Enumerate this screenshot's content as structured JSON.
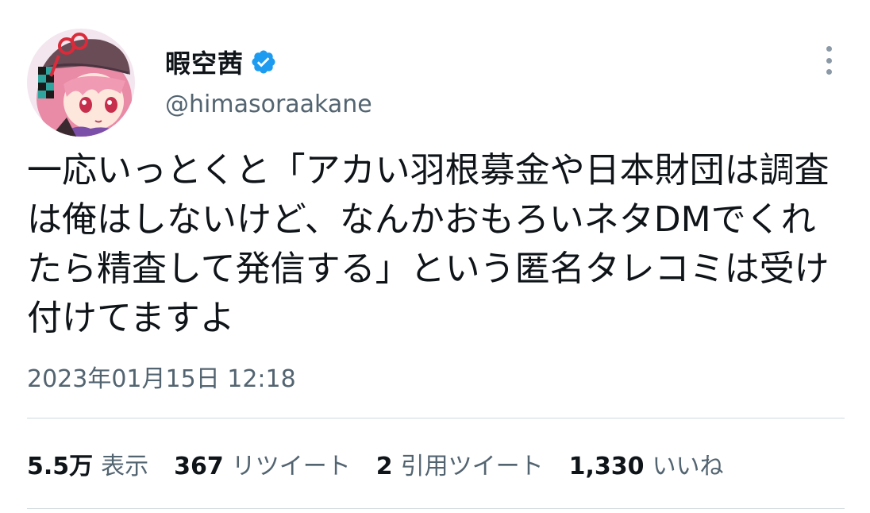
{
  "user": {
    "display_name": "暇空茜",
    "handle": "@himasoraakane",
    "verified": true,
    "verified_color": "#1d9bf0"
  },
  "tweet": {
    "text": "一応いっとくと「アカい羽根募金や日本財団は調査は俺はしないけど、なんかおもろいネタDMでくれたら精査して発信する」という匿名タレコミは受け付けてますよ",
    "timestamp": "2023年01月15日 12:18"
  },
  "stats": [
    {
      "value": "5.5万",
      "label": "表示"
    },
    {
      "value": "367",
      "label": "リツイート"
    },
    {
      "value": "2",
      "label": "引用ツイート"
    },
    {
      "value": "1,330",
      "label": "いいね"
    }
  ],
  "icons": {
    "avatar": "anime-avatar",
    "verified": "verified-badge-icon",
    "more": "more-options-icon"
  }
}
